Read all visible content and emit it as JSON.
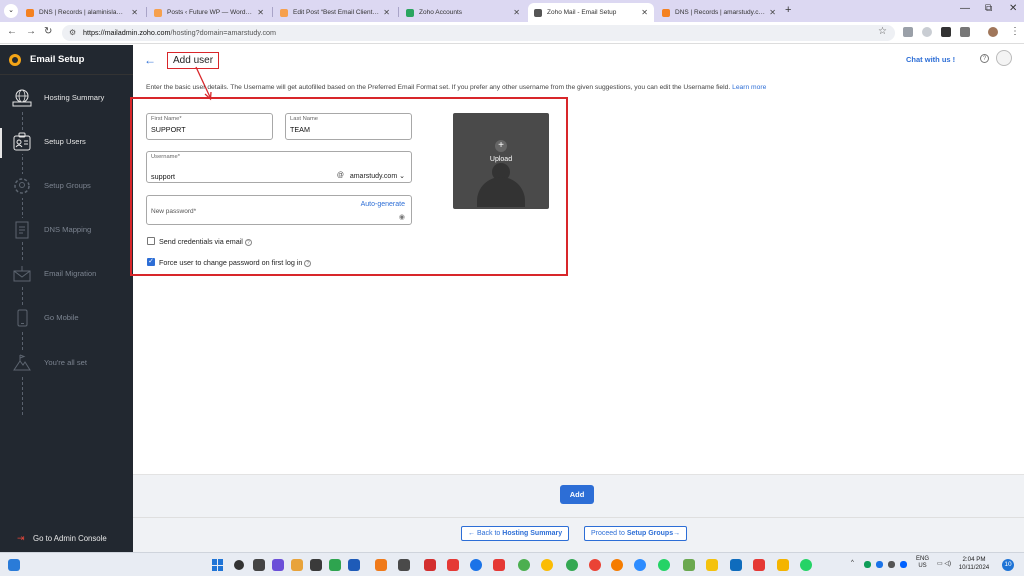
{
  "browser": {
    "tabs": [
      {
        "title": "DNS | Records | alaminislam.me",
        "favicon_color": "#f48120"
      },
      {
        "title": "Posts ‹ Future WP — WordPress",
        "favicon_color": "#f6a04d"
      },
      {
        "title": "Edit Post “Best Email Client For",
        "favicon_color": "#f6a04d"
      },
      {
        "title": "Zoho Accounts",
        "favicon_color": "#2aa55f"
      },
      {
        "title": "Zoho Mail - Email Setup",
        "favicon_color": "#555555"
      },
      {
        "title": "DNS | Records | amarstudy.com",
        "favicon_color": "#f48120"
      }
    ],
    "active_tab_index": 4,
    "url_host": "https://mailadmin.zoho.com",
    "url_path": "/hosting?domain=amarstudy.com"
  },
  "sidebar": {
    "title": "Email Setup",
    "items": [
      {
        "label": "Hosting Summary",
        "icon": "globe-server-icon",
        "state": "done"
      },
      {
        "label": "Setup Users",
        "icon": "user-card-icon",
        "state": "current"
      },
      {
        "label": "Setup Groups",
        "icon": "group-gear-icon",
        "state": "pending"
      },
      {
        "label": "DNS Mapping",
        "icon": "dns-document-icon",
        "state": "pending"
      },
      {
        "label": "Email Migration",
        "icon": "mail-migrate-icon",
        "state": "pending"
      },
      {
        "label": "Go Mobile",
        "icon": "mobile-icon",
        "state": "pending"
      },
      {
        "label": "You're all set",
        "icon": "mountain-flag-icon",
        "state": "pending"
      }
    ],
    "footer_label": "Go to Admin Console"
  },
  "header": {
    "title": "Add user",
    "chat_label": "Chat with us !"
  },
  "intro": {
    "text": "Enter the basic user details. The Username will get autofilled based on the Preferred Email Format set. If you prefer any other username from the given suggestions, you can edit the Username field.",
    "link": "Learn more"
  },
  "form": {
    "first_name": {
      "label": "First Name",
      "value": "SUPPORT"
    },
    "last_name": {
      "label": "Last Name",
      "value": "TEAM"
    },
    "username": {
      "label": "Username",
      "value": "support",
      "at": "@",
      "domain": "amarstudy.com"
    },
    "password": {
      "label": "New password",
      "autogen": "Auto-generate"
    },
    "send_credentials": {
      "label": "Send credentials via email",
      "checked": false
    },
    "force_change": {
      "label": "Force user to change password on first log in",
      "checked": true
    },
    "upload_label": "Upload",
    "required_mark": "*"
  },
  "footer": {
    "add_label": "Add",
    "back_prefix": "Back to",
    "back_target": "Hosting Summary",
    "proceed_prefix": "Proceed to",
    "proceed_target": "Setup Groups"
  },
  "taskbar": {
    "lang_top": "ENG",
    "lang_bottom": "US",
    "time": "2:04 PM",
    "date": "10/11/2024",
    "notification_count": "10"
  },
  "colors": {
    "accent": "#2d6ed6",
    "sidebar_bg": "#222830",
    "highlight_red": "#d8262a"
  }
}
